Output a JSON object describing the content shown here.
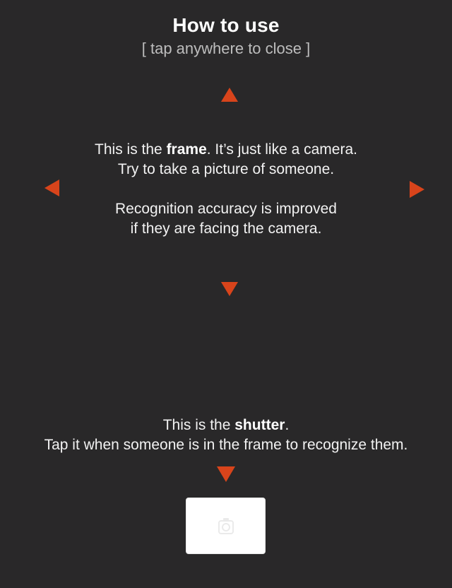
{
  "header": {
    "title": "How to use",
    "subtitle": "[ tap anywhere to close ]"
  },
  "frame_help": {
    "line1_prefix": "This is the ",
    "line1_bold": "frame",
    "line1_suffix": ". It’s just like a camera.",
    "line2": "Try to take a picture of someone.",
    "line3": "Recognition accuracy is improved",
    "line4": "if they are facing the camera."
  },
  "shutter_help": {
    "line1_prefix": "This is the ",
    "line1_bold": "shutter",
    "line1_suffix": ".",
    "line2": "Tap it when someone is in the frame to recognize them."
  },
  "icons": {
    "arrows": "triangle-arrow-icon",
    "shutter": "camera-icon"
  },
  "colors": {
    "background": "#292829",
    "accent": "#d8441b",
    "text": "#f2f2f2",
    "subtitle": "#bdbdbd",
    "shutter": "#ffffff"
  }
}
